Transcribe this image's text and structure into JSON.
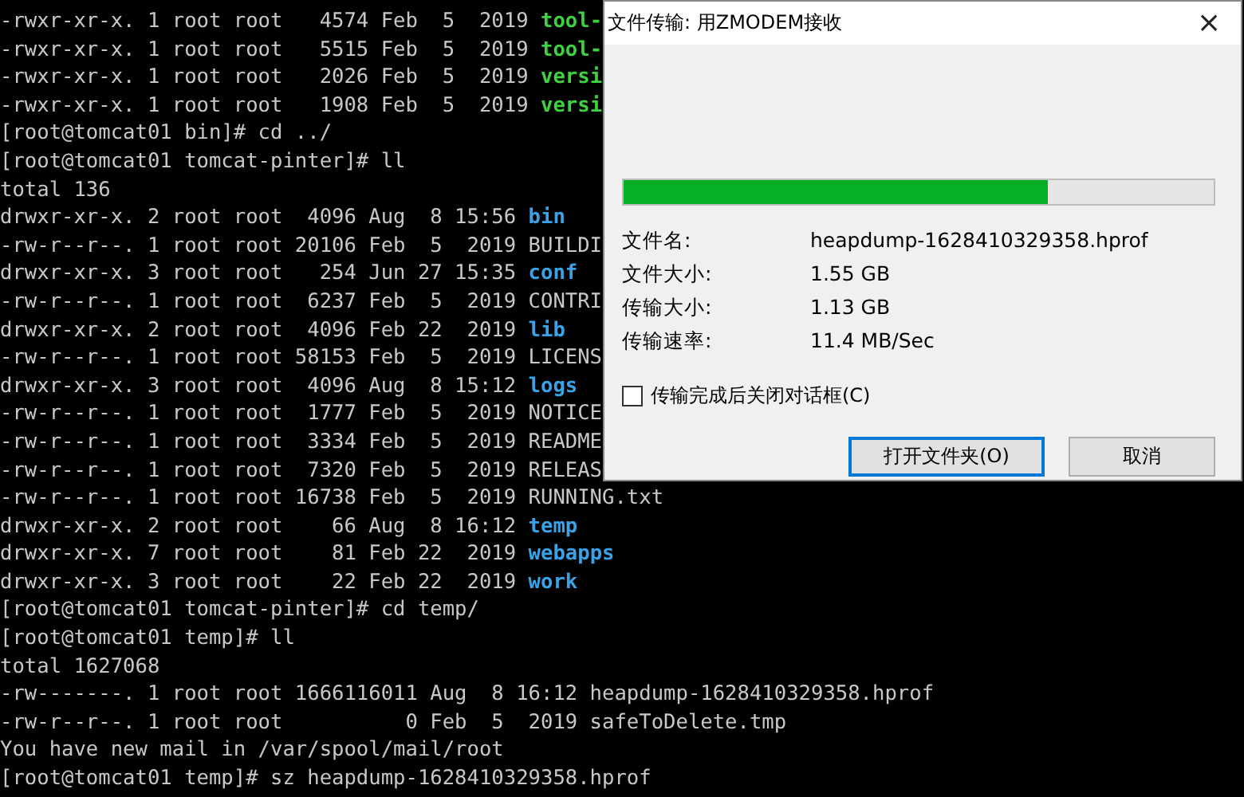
{
  "terminal": {
    "lines": [
      {
        "segments": [
          {
            "text": "-rwxr-xr-x. 1 root root   4574 Feb  5  2019 ",
            "kind": "plain"
          },
          {
            "text": "tool-",
            "kind": "exec"
          }
        ]
      },
      {
        "segments": [
          {
            "text": "-rwxr-xr-x. 1 root root   5515 Feb  5  2019 ",
            "kind": "plain"
          },
          {
            "text": "tool-",
            "kind": "exec"
          }
        ]
      },
      {
        "segments": [
          {
            "text": "-rwxr-xr-x. 1 root root   2026 Feb  5  2019 ",
            "kind": "plain"
          },
          {
            "text": "versi",
            "kind": "exec"
          }
        ]
      },
      {
        "segments": [
          {
            "text": "-rwxr-xr-x. 1 root root   1908 Feb  5  2019 ",
            "kind": "plain"
          },
          {
            "text": "versi",
            "kind": "exec"
          }
        ]
      },
      {
        "segments": [
          {
            "text": "[root@tomcat01 bin]# cd ../",
            "kind": "plain"
          }
        ]
      },
      {
        "segments": [
          {
            "text": "[root@tomcat01 tomcat-pinter]# ll",
            "kind": "plain"
          }
        ]
      },
      {
        "segments": [
          {
            "text": "total 136",
            "kind": "plain"
          }
        ]
      },
      {
        "segments": [
          {
            "text": "drwxr-xr-x. 2 root root  4096 Aug  8 15:56 ",
            "kind": "plain"
          },
          {
            "text": "bin",
            "kind": "dir"
          }
        ]
      },
      {
        "segments": [
          {
            "text": "-rw-r--r--. 1 root root 20106 Feb  5  2019 BUILDI",
            "kind": "plain"
          }
        ]
      },
      {
        "segments": [
          {
            "text": "drwxr-xr-x. 3 root root   254 Jun 27 15:35 ",
            "kind": "plain"
          },
          {
            "text": "conf",
            "kind": "dir"
          }
        ]
      },
      {
        "segments": [
          {
            "text": "-rw-r--r--. 1 root root  6237 Feb  5  2019 CONTRI",
            "kind": "plain"
          }
        ]
      },
      {
        "segments": [
          {
            "text": "drwxr-xr-x. 2 root root  4096 Feb 22  2019 ",
            "kind": "plain"
          },
          {
            "text": "lib",
            "kind": "dir"
          }
        ]
      },
      {
        "segments": [
          {
            "text": "-rw-r--r--. 1 root root 58153 Feb  5  2019 LICENS",
            "kind": "plain"
          }
        ]
      },
      {
        "segments": [
          {
            "text": "drwxr-xr-x. 3 root root  4096 Aug  8 15:12 ",
            "kind": "plain"
          },
          {
            "text": "logs",
            "kind": "dir"
          }
        ]
      },
      {
        "segments": [
          {
            "text": "-rw-r--r--. 1 root root  1777 Feb  5  2019 NOTICE",
            "kind": "plain"
          }
        ]
      },
      {
        "segments": [
          {
            "text": "-rw-r--r--. 1 root root  3334 Feb  5  2019 README",
            "kind": "plain"
          }
        ]
      },
      {
        "segments": [
          {
            "text": "-rw-r--r--. 1 root root  7320 Feb  5  2019 RELEAS",
            "kind": "plain"
          }
        ]
      },
      {
        "segments": [
          {
            "text": "-rw-r--r--. 1 root root 16738 Feb  5  2019 RUNNING.txt",
            "kind": "plain"
          }
        ]
      },
      {
        "segments": [
          {
            "text": "drwxr-xr-x. 2 root root    66 Aug  8 16:12 ",
            "kind": "plain"
          },
          {
            "text": "temp",
            "kind": "dir"
          }
        ]
      },
      {
        "segments": [
          {
            "text": "drwxr-xr-x. 7 root root    81 Feb 22  2019 ",
            "kind": "plain"
          },
          {
            "text": "webapps",
            "kind": "dir"
          }
        ]
      },
      {
        "segments": [
          {
            "text": "drwxr-xr-x. 3 root root    22 Feb 22  2019 ",
            "kind": "plain"
          },
          {
            "text": "work",
            "kind": "dir"
          }
        ]
      },
      {
        "segments": [
          {
            "text": "[root@tomcat01 tomcat-pinter]# cd temp/",
            "kind": "plain"
          }
        ]
      },
      {
        "segments": [
          {
            "text": "[root@tomcat01 temp]# ll",
            "kind": "plain"
          }
        ]
      },
      {
        "segments": [
          {
            "text": "total 1627068",
            "kind": "plain"
          }
        ]
      },
      {
        "segments": [
          {
            "text": "-rw-------. 1 root root 1666116011 Aug  8 16:12 heapdump-1628410329358.hprof",
            "kind": "plain"
          }
        ]
      },
      {
        "segments": [
          {
            "text": "-rw-r--r--. 1 root root          0 Feb  5  2019 safeToDelete.tmp",
            "kind": "plain"
          }
        ]
      },
      {
        "segments": [
          {
            "text": "You have new mail in /var/spool/mail/root",
            "kind": "plain"
          }
        ]
      },
      {
        "segments": [
          {
            "text": "[root@tomcat01 temp]# sz heapdump-1628410329358.hprof",
            "kind": "plain"
          }
        ]
      }
    ]
  },
  "dialog": {
    "title": "文件传输: 用ZMODEM接收",
    "close": "×",
    "progress": {
      "level": 0.72
    },
    "fields": [
      {
        "label": "文件名:",
        "value": "heapdump-1628410329358.hprof"
      },
      {
        "label": "文件大小:",
        "value": "1.55 GB"
      },
      {
        "label": "传输大小:",
        "value": "1.13 GB"
      },
      {
        "label": "传输速率:",
        "value": "11.4 MB/Sec"
      }
    ],
    "close_when_done": {
      "label": "传输完成后关闭对话框(C)",
      "checked": false
    },
    "buttons": [
      {
        "label": "打开文件夹(O)",
        "default": true
      },
      {
        "label": "取消",
        "default": false
      }
    ]
  }
}
